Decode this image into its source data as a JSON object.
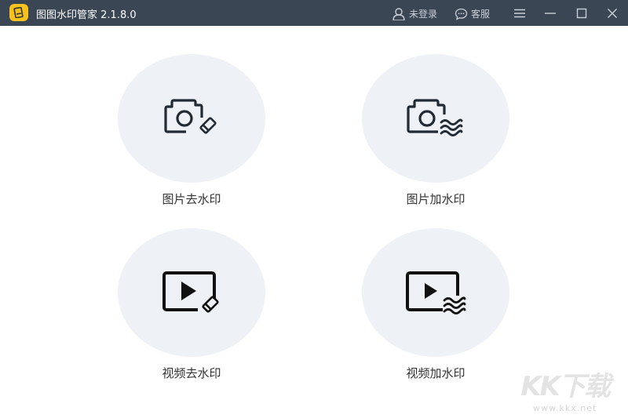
{
  "window": {
    "title": "图图水印管家  2.1.8.0"
  },
  "titlebar": {
    "login": "未登录",
    "service": "客服"
  },
  "cards": [
    {
      "label": "图片去水印",
      "icon": "camera-eraser-icon"
    },
    {
      "label": "图片加水印",
      "icon": "camera-waves-icon"
    },
    {
      "label": "视频去水印",
      "icon": "video-eraser-icon"
    },
    {
      "label": "视频加水印",
      "icon": "video-waves-icon"
    }
  ],
  "watermark": {
    "brand": "KK下载",
    "url": "www.kkx.net"
  }
}
